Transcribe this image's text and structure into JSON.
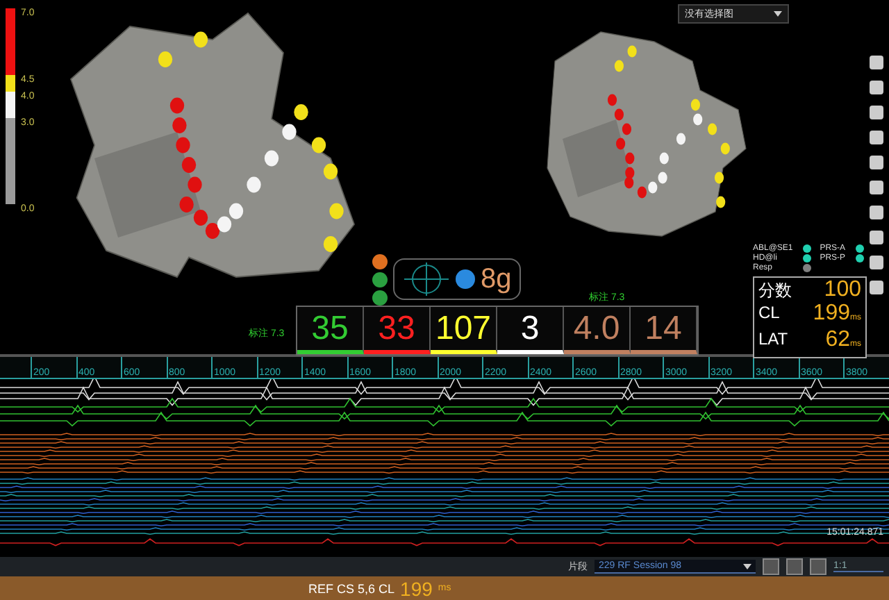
{
  "scale": {
    "ticks": [
      "7.0",
      "4.5",
      "4.0",
      "3.0",
      "0.0"
    ]
  },
  "maps": [
    {
      "label": "标注 7.3"
    },
    {
      "label": "标注 7.3"
    }
  ],
  "map_selector": {
    "value": "没有选择图"
  },
  "force": {
    "value": "8g"
  },
  "metrics": [
    {
      "value": "35",
      "color": "#33cc33"
    },
    {
      "value": "33",
      "color": "#ff2020"
    },
    {
      "value": "107",
      "color": "#ffff30"
    },
    {
      "value": "3",
      "color": "#ffffff"
    },
    {
      "value": "4.0",
      "color": "#c08060"
    },
    {
      "value": "14",
      "color": "#c08060"
    }
  ],
  "legend": [
    {
      "label": "ABL@SE1",
      "color": "#20d0b0"
    },
    {
      "label": "PRS-A",
      "color": "#20d0b0"
    },
    {
      "label": "HD@li",
      "color": "#20d0b0"
    },
    {
      "label": "PRS-P",
      "color": "#20d0b0"
    },
    {
      "label": "Resp",
      "color": "#808080"
    }
  ],
  "stats": [
    {
      "label": "分数",
      "value": "100"
    },
    {
      "label": "CL",
      "value": "199",
      "unit": "ms"
    },
    {
      "label": "LAT",
      "value": "62",
      "unit": "ms"
    }
  ],
  "timeline": {
    "ticks": [
      "200",
      "400",
      "600",
      "800",
      "1000",
      "1200",
      "1400",
      "1600",
      "1800",
      "2000",
      "2200",
      "2400",
      "2600",
      "2800",
      "3000",
      "3200",
      "3400",
      "3600",
      "3800"
    ]
  },
  "timestamp": "15:01:24.871",
  "segment": {
    "label": "片段",
    "value": "229  RF Session 98"
  },
  "zoom": "1:1",
  "status_bar": {
    "label": "REF CS 5,6 CL",
    "value": "199",
    "unit": "ms"
  }
}
